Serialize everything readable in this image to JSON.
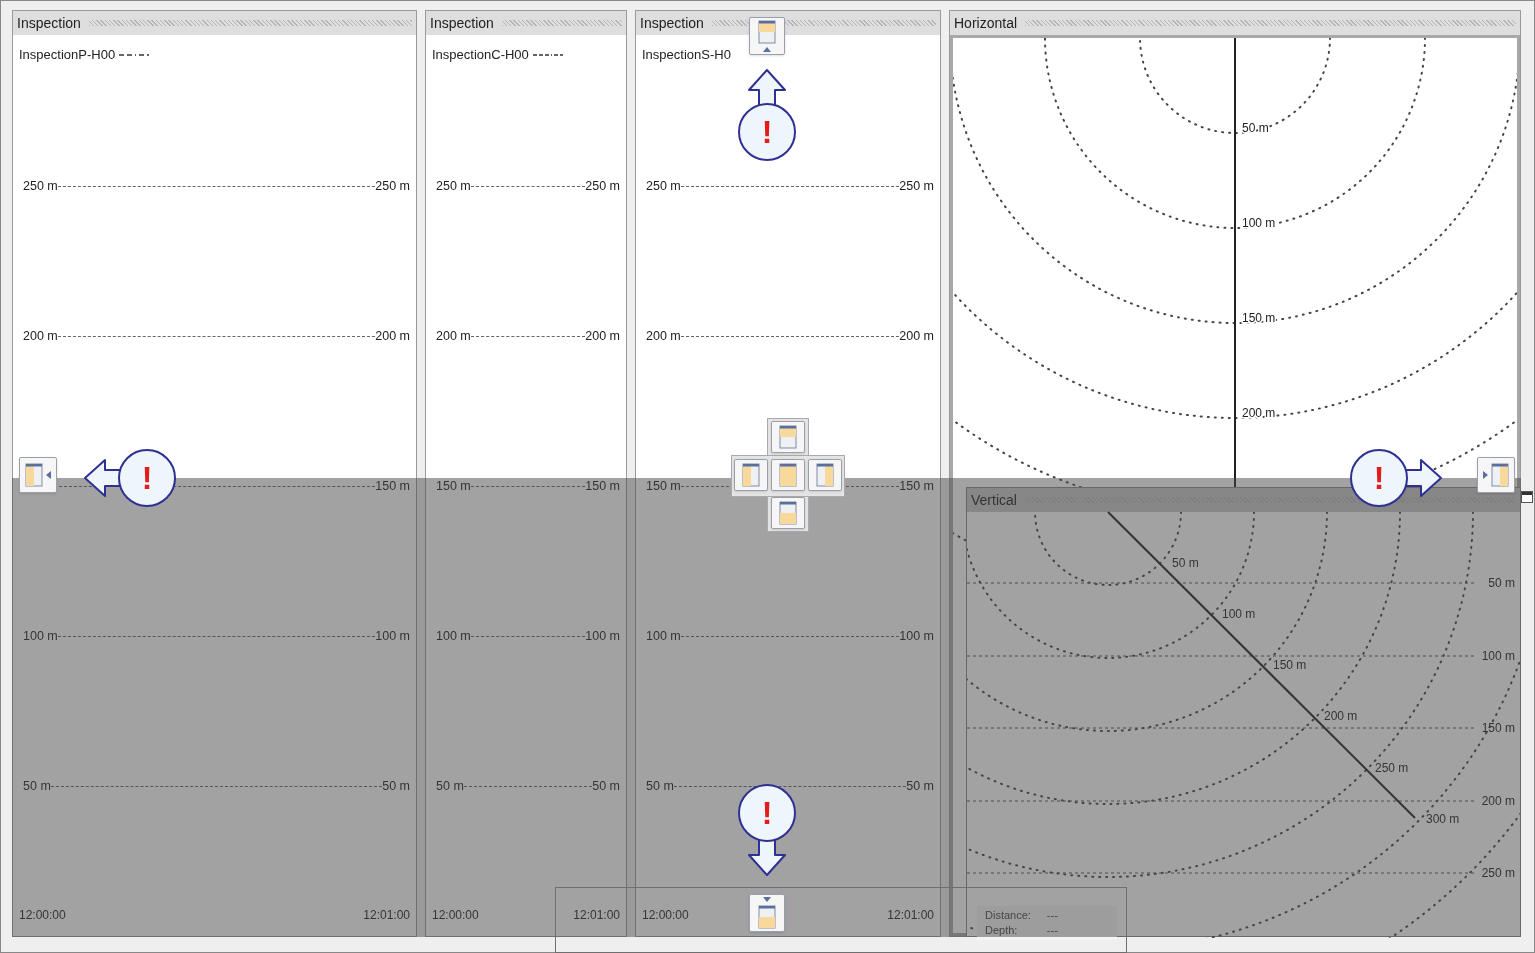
{
  "panels": [
    {
      "title": "Inspection",
      "legend": "InspectionP-H00",
      "kind": "dash-dash-dot",
      "ticks": [
        {
          "left": "250 m",
          "right": "250 m"
        },
        {
          "left": "200 m",
          "right": "200 m"
        },
        {
          "right": "150 m"
        },
        {
          "left": "100 m",
          "right": "100 m"
        },
        {
          "left": "50 m",
          "right": "50 m"
        }
      ],
      "time_start": "12:00:00",
      "time_end": "12:01:00"
    },
    {
      "title": "Inspection",
      "legend": "InspectionC-H00",
      "kind": "dash-dash-dash-dot",
      "ticks": [
        {
          "left": "250 m",
          "right": "250 m"
        },
        {
          "left": "200 m",
          "right": "200 m"
        },
        {
          "left": "150 m",
          "right": "150 m"
        },
        {
          "left": "100 m",
          "right": "100 m"
        },
        {
          "left": "50 m",
          "right": "50 m"
        }
      ],
      "time_start": "12:00:00",
      "time_end": "12:01:00"
    },
    {
      "title": "Inspection",
      "legend": "InspectionS-H0",
      "ticks": [
        {
          "left": "250 m",
          "right": "250 m"
        },
        {
          "left": "200 m",
          "right": "200 m"
        },
        {
          "left": "150 m",
          "right": "150 m"
        },
        {
          "left": "100 m",
          "right": "100 m"
        },
        {
          "left": "50 m",
          "right": "50 m"
        }
      ],
      "time_start": "12:00:00",
      "time_end": "12:01:00"
    }
  ],
  "horizontal": {
    "title": "Horizontal",
    "ring_labels": [
      "50 m",
      "100 m",
      "150 m",
      "200 m"
    ]
  },
  "vertical": {
    "title": "Vertical",
    "ring_labels": [
      "50 m",
      "100 m",
      "150 m",
      "200 m",
      "250 m",
      "300 m"
    ],
    "depth_labels": [
      "50 m",
      "100 m",
      "150 m",
      "200 m",
      "250 m"
    ],
    "readouts": [
      {
        "label": "Distance:",
        "value": "---"
      },
      {
        "label": "Depth:",
        "value": "---"
      }
    ]
  },
  "callouts": [
    {
      "kind": "up",
      "mark": "!"
    },
    {
      "kind": "left",
      "mark": "!"
    },
    {
      "kind": "right",
      "mark": "!"
    },
    {
      "kind": "down",
      "mark": "!"
    }
  ]
}
